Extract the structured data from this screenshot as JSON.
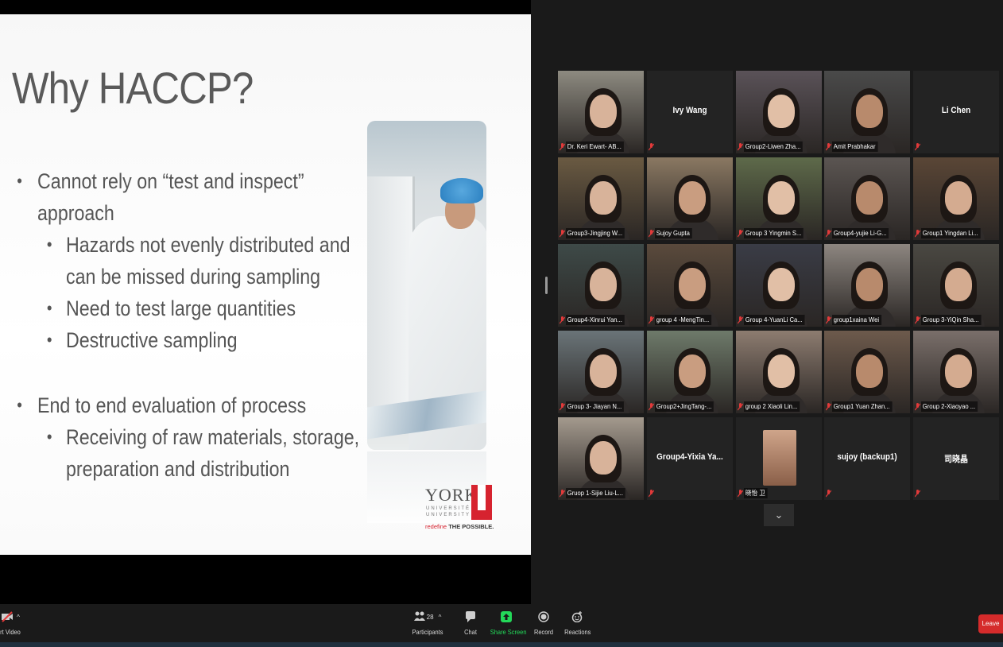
{
  "slide": {
    "title": "Why HACCP?",
    "bullets": [
      {
        "level": 1,
        "text": "Cannot rely on “test and inspect”"
      },
      {
        "level": 1,
        "text": "approach",
        "continuation": true
      },
      {
        "level": 2,
        "text": "Hazards not evenly distributed and"
      },
      {
        "level": 2,
        "text": "can be missed during sampling",
        "continuation": true
      },
      {
        "level": 2,
        "text": "Need to test large quantities"
      },
      {
        "level": 2,
        "text": "Destructive sampling"
      },
      {
        "level": 1,
        "text": "End to end evaluation of process"
      },
      {
        "level": 2,
        "text": "Receiving of raw materials, storage,"
      },
      {
        "level": 2,
        "text": "preparation and distribution",
        "continuation": true
      }
    ],
    "bullet_char": "•",
    "logo": {
      "word": "YORK",
      "sub": "UNIVERSITY\nUNIVERSITÉ",
      "tag_pre": "redefine",
      "tag_post": "THE POSSIBLE."
    }
  },
  "participants": [
    {
      "name": "Dr. Keri Ewart- AB...",
      "video": true,
      "bg": "#8d8a80"
    },
    {
      "name": "Ivy Wang",
      "video": false
    },
    {
      "name": "Group2-Liwen Zha...",
      "video": true,
      "bg": "#5a5258"
    },
    {
      "name": "Amit Prabhakar",
      "video": true,
      "active": true,
      "bg": "#4a4a4a"
    },
    {
      "name": "Li Chen",
      "video": false
    },
    {
      "name": "Group3-Jingjing W...",
      "video": true,
      "bg": "#6a5a42"
    },
    {
      "name": "Sujoy Gupta",
      "video": true,
      "bg": "#8a7862"
    },
    {
      "name": "Group 3 Yingmin S...",
      "video": true,
      "bg": "#5e6a4a"
    },
    {
      "name": "Group4-yujie Li-G...",
      "video": true,
      "bg": "#5b5552"
    },
    {
      "name": "Group1 Yingdan Li...",
      "video": true,
      "bg": "#5a4636"
    },
    {
      "name": "Group4-Xinrui Yan...",
      "video": true,
      "bg": "#3e4a48"
    },
    {
      "name": "group 4 -MengTin...",
      "video": true,
      "bg": "#5a4a3c"
    },
    {
      "name": "Group 4-YuanLi Ca...",
      "video": true,
      "bg": "#3a3c46"
    },
    {
      "name": "group1xaina Wei",
      "video": true,
      "bg": "#8d8680"
    },
    {
      "name": "Group 3-YiQin Sha...",
      "video": true,
      "bg": "#4a4842"
    },
    {
      "name": "Group 3- Jiayan N...",
      "video": true,
      "bg": "#6a7478"
    },
    {
      "name": "Group2+JingTang-...",
      "video": true,
      "bg": "#6e7a6a"
    },
    {
      "name": "group 2 Xiaoli Lin...",
      "video": true,
      "bg": "#8d7c70"
    },
    {
      "name": "Group1 Yuan Zhan...",
      "video": true,
      "bg": "#6d5a4c"
    },
    {
      "name": "Group 2-Xiaoyao ...",
      "video": true,
      "bg": "#7a6f6a"
    },
    {
      "name": "Gruop 1-Sijie Liu-L...",
      "video": true,
      "bg": "#a49a8e"
    },
    {
      "name": "Group4-Yixia  Ya...",
      "video": false
    },
    {
      "name": "晓怡 卫",
      "video": true,
      "portrait": true,
      "bg": "#232323"
    },
    {
      "name": "sujoy (backup1)",
      "video": false
    },
    {
      "name": "司晓晶",
      "video": false
    }
  ],
  "gallery_more": "v",
  "toolbar": {
    "video_label": "rt Video",
    "participants_label": "Participants",
    "participants_count": "28",
    "chat_label": "Chat",
    "share_label": "Share Screen",
    "record_label": "Record",
    "reactions_label": "Reactions",
    "leave_label": "Leave"
  }
}
